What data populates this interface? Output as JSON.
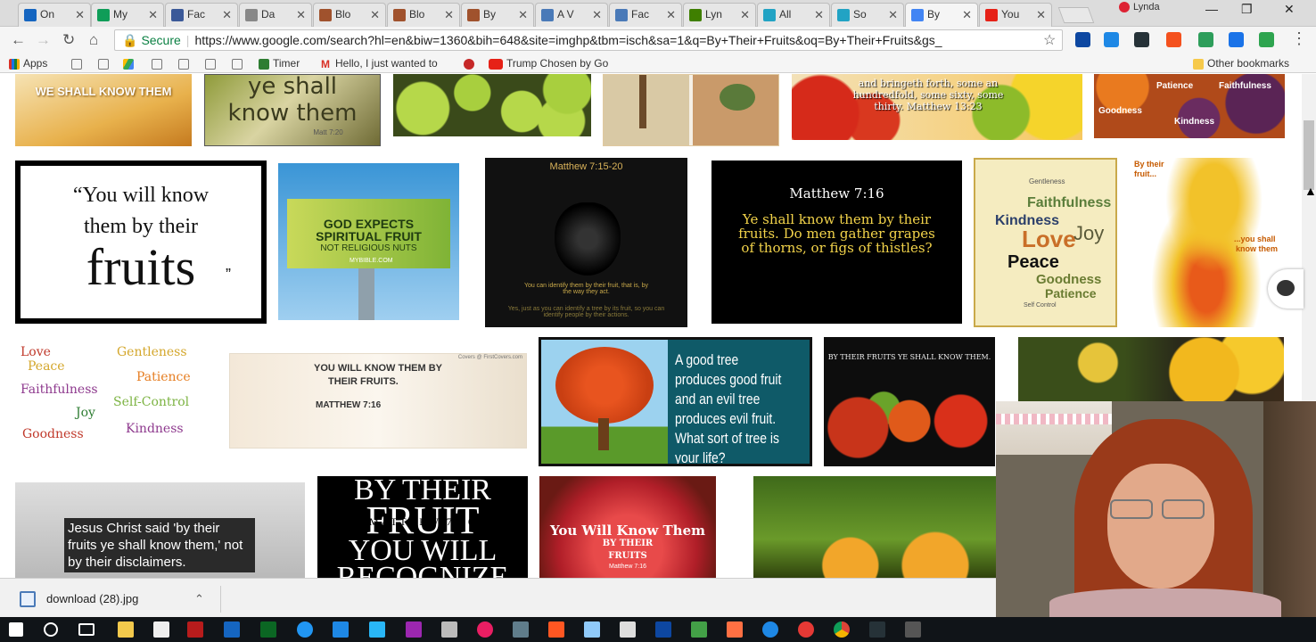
{
  "tabs": [
    {
      "title": "On",
      "color": "#1565c0"
    },
    {
      "title": "My",
      "color": "#0f9d58"
    },
    {
      "title": "Fac",
      "color": "#3b5998"
    },
    {
      "title": "Da",
      "color": "#888888"
    },
    {
      "title": "Blo",
      "color": "#a0522d"
    },
    {
      "title": "Blo",
      "color": "#a0522d"
    },
    {
      "title": "By",
      "color": "#a0522d"
    },
    {
      "title": "A V",
      "color": "#4a7ab8"
    },
    {
      "title": "Fac",
      "color": "#4a7ab8"
    },
    {
      "title": "Lyn",
      "color": "#3f7f00"
    },
    {
      "title": "All",
      "color": "#22a3c4"
    },
    {
      "title": "So",
      "color": "#22a3c4"
    },
    {
      "title": "By",
      "color": "#4285f4"
    },
    {
      "title": "You",
      "color": "#e62117"
    }
  ],
  "tab_close": "✕",
  "profile_name": "Lynda",
  "window_controls": {
    "minimize": "—",
    "maximize": "❐",
    "close": "✕"
  },
  "nav": {
    "back": "←",
    "forward": "→",
    "reload": "↻",
    "home": "⌂"
  },
  "address": {
    "secure_label": "Secure",
    "url": "https://www.google.com/search?hl=en&biw=1360&bih=648&site=imghp&tbm=isch&sa=1&q=By+Their+Fruits&oq=By+Their+Fruits&gs_"
  },
  "bookmarks": {
    "apps": "Apps",
    "timer": "Timer",
    "gmail": "Hello, I just wanted to",
    "youtube": "Trump Chosen by Go",
    "other": "Other bookmarks"
  },
  "images": {
    "r0c0": "WE SHALL KNOW THEM",
    "r0c1_a": "ye shall",
    "r0c1_b": "know them",
    "r0c1_c": "Matt 7:20",
    "r0c4": "and bringeth forth, some an hundredfold, some sixty, some thirty. Matthew 13:23",
    "r0c5_a": "Patience",
    "r0c5_b": "Faithfulness",
    "r0c5_c": "Kindness",
    "r0c5_d": "Goodness",
    "q1_a": "“You will know",
    "q1_b": "them by their",
    "q1_c": "fruits",
    "q1_d": "”",
    "bb_a": "GOD EXPECTS",
    "bb_b": "SPIRITUAL FRUIT",
    "bb_c": "NOT RELIGIOUS NUTS",
    "bb_d": "MYBIBLE.COM",
    "sb_a": "Matthew 7:15-20",
    "sb_b": "You can identify them by their fruit, that is, by the way they act.",
    "sb_c": "Yes, just as you can identify a tree by its fruit, so you can identify people by their actions.",
    "m16_a": "Matthew 7:16",
    "m16_b": "Ye shall know them by their fruits. Do men gather grapes of thorns, or figs of thistles?",
    "wc_love": "Love",
    "wc_joy": "Joy",
    "wc_peace": "Peace",
    "wc_kind": "Kindness",
    "wc_faith": "Faithfulness",
    "wc_good": "Goodness",
    "wc_pat": "Patience",
    "wc_gentle": "Gentleness",
    "wc_self": "Self Control",
    "fb_a": "By their",
    "fb_b": "fruit...",
    "fb_c": "...you shall",
    "fb_d": "know them",
    "fr_love": "Love",
    "fr_peace": "Peace",
    "fr_faith": "Faithfulness",
    "fr_joy": "Joy",
    "fr_good": "Goodness",
    "fr_gentle": "Gentleness",
    "fr_pat": "Patience",
    "fr_self": "Self-Control",
    "fr_kind": "Kindness",
    "yk_a": "YOU WILL KNOW THEM BY",
    "yk_b": "THEIR FRUITS.",
    "yk_c": "MATTHEW 7:16",
    "yk_d": "Covers @ FirstCovers.com",
    "gt": "A good tree produces good fruit and an evil tree produces evil fruit. What sort of tree is your life?",
    "tom": "BY THEIR FRUITS YE SHALL KNOW THEM.",
    "jc": "Jesus Christ said 'by their fruits ye shall know them,' not by their disclaimers.",
    "btf_a": "BY THEIR",
    "btf_b": "FRUIT",
    "btf_c": "MATTHEW 7:20",
    "btf_d": "YOU WILL",
    "btf_e": "RECOGNIZE",
    "pom_a": "You Will Know Them",
    "pom_b": "BY THEIR",
    "pom_c": "FRUITS",
    "pom_d": "Matthew 7:16"
  },
  "download": {
    "filename": "download (28).jpg",
    "chevron": "⌃"
  }
}
